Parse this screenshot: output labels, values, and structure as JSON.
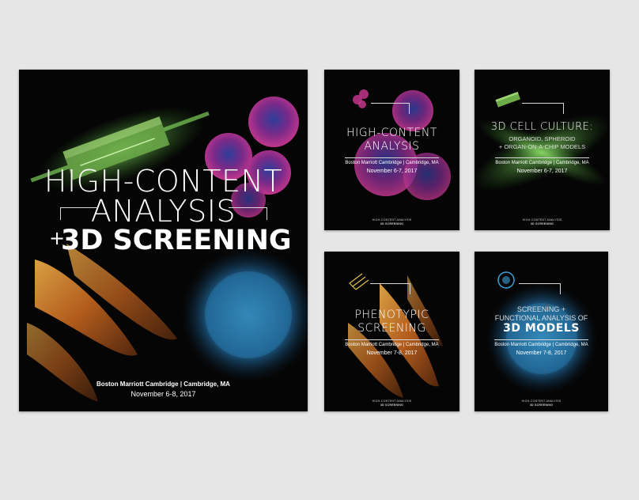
{
  "main_cover": {
    "title_line1": "HIGH-CONTENT",
    "title_line2": "ANALYSIS",
    "plus": "+",
    "title_line3": "3D SCREENING",
    "venue": "Boston Marriott Cambridge  |  Cambridge, MA",
    "date": "November 6-8, 2017"
  },
  "covers": [
    {
      "title_line1": "HIGH-CONTENT",
      "title_line2": "ANALYSIS",
      "venue": "Boston Marriott Cambridge  |  Cambridge, MA",
      "date": "November 6-7, 2017",
      "footer1": "HIGH-CONTENT ANALYSIS",
      "footer2": "3D SCREENING"
    },
    {
      "title_line1": "3D CELL CULTURE:",
      "sub_line1": "ORGANOID, SPHEROID",
      "sub_line2": "+ ORGAN-ON-A-CHIP MODELS",
      "venue": "Boston Marriott Cambridge  |  Cambridge, MA",
      "date": "November 6-7, 2017",
      "footer1": "HIGH-CONTENT ANALYSIS",
      "footer2": "3D SCREENING"
    },
    {
      "title_line1": "PHENOTYPIC",
      "title_line2": "SCREENING",
      "venue": "Boston Marriott Cambridge  |  Cambridge, MA",
      "date": "November 7-8, 2017",
      "footer1": "HIGH-CONTENT ANALYSIS",
      "footer2": "3D SCREENING"
    },
    {
      "sub_line1": "SCREENING +",
      "sub_line2": "FUNCTIONAL ANALYSIS OF",
      "title_line1": "3D MODELS",
      "venue": "Boston Marriott Cambridge  |  Cambridge, MA",
      "date": "November 7-8, 2017",
      "footer1": "HIGH-CONTENT ANALYSIS",
      "footer2": "3D SCREENING"
    }
  ],
  "colors": {
    "background": "#e6e6e6",
    "cover_bg": "#050505",
    "green": "#7fd85a",
    "magenta": "#c2368c",
    "blue": "#2a74a8",
    "orange": "#d9822a"
  },
  "icons": {
    "chip": "organ-on-chip-icon",
    "cells": "cell-cluster-icon",
    "neuron": "neuron-icon",
    "spheroid": "spheroid-icon"
  }
}
